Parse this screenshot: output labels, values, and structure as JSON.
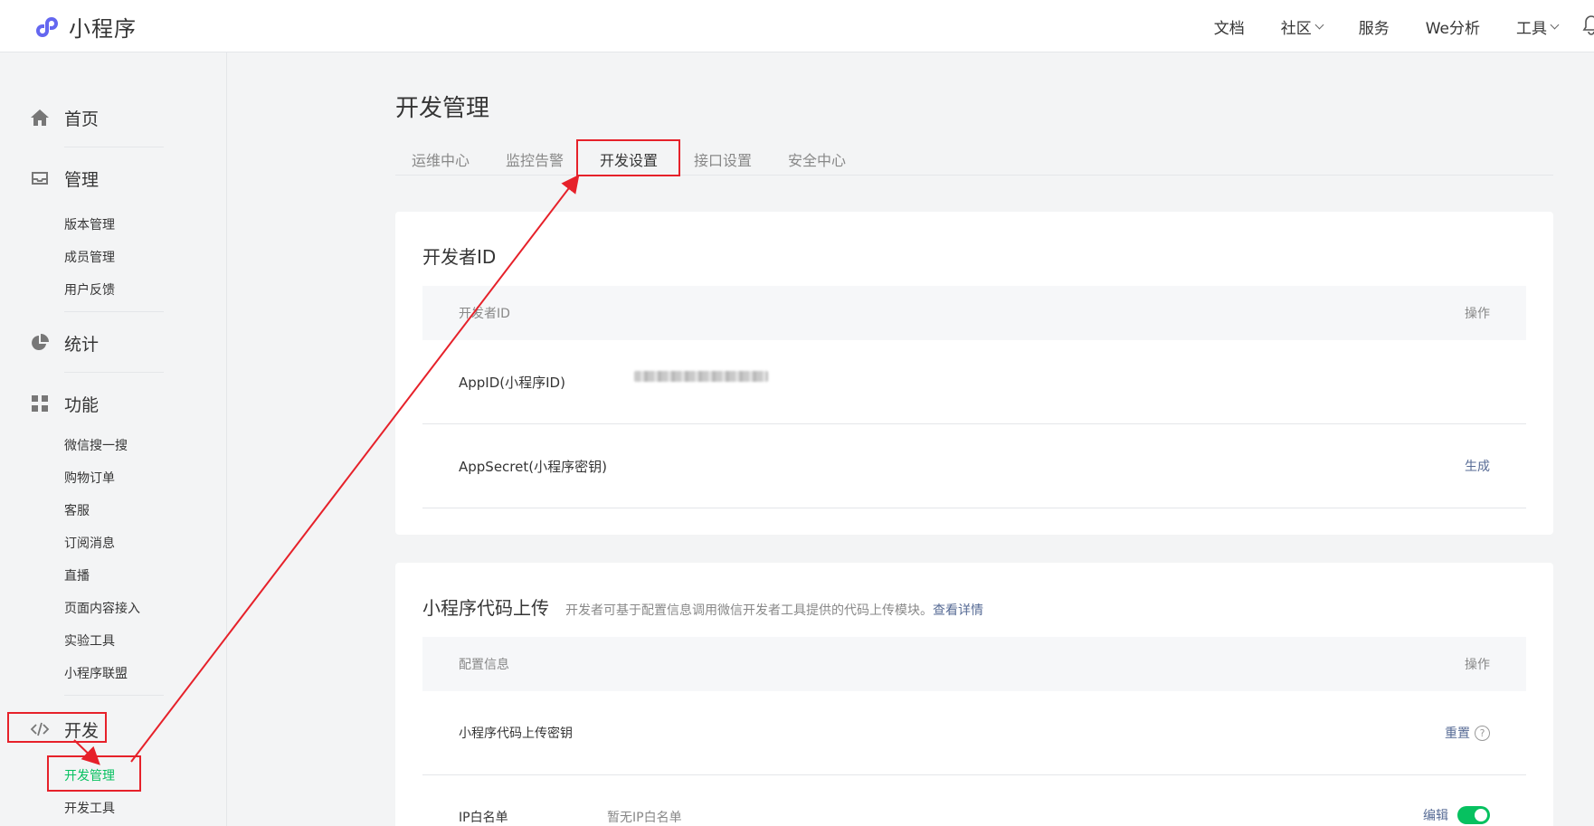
{
  "header": {
    "brand": "小程序",
    "nav": [
      {
        "label": "文档",
        "dropdown": false
      },
      {
        "label": "社区",
        "dropdown": true
      },
      {
        "label": "服务",
        "dropdown": false
      },
      {
        "label": "We分析",
        "dropdown": false
      },
      {
        "label": "工具",
        "dropdown": true
      }
    ]
  },
  "sidebar": {
    "home": "首页",
    "manage": "管理",
    "manage_items": [
      "版本管理",
      "成员管理",
      "用户反馈"
    ],
    "stats": "统计",
    "features": "功能",
    "feature_items": [
      "微信搜一搜",
      "购物订单",
      "客服",
      "订阅消息",
      "直播",
      "页面内容接入",
      "实验工具",
      "小程序联盟"
    ],
    "dev": "开发",
    "dev_items": [
      "开发管理",
      "开发工具"
    ]
  },
  "main": {
    "title": "开发管理",
    "tabs": [
      "运维中心",
      "监控告警",
      "开发设置",
      "接口设置",
      "安全中心"
    ],
    "active_tab": "开发设置",
    "developer_card": {
      "title": "开发者ID",
      "col_info": "开发者ID",
      "col_action": "操作",
      "rows": [
        {
          "label": "AppID(小程序ID)",
          "action": ""
        },
        {
          "label": "AppSecret(小程序密钥)",
          "action": "生成"
        }
      ]
    },
    "upload_card": {
      "title": "小程序代码上传",
      "desc": "开发者可基于配置信息调用微信开发者工具提供的代码上传模块。",
      "desc_link": "查看详情",
      "col_info": "配置信息",
      "col_action": "操作",
      "rows": [
        {
          "label": "小程序代码上传密钥",
          "value": "",
          "action": "重置"
        },
        {
          "label": "IP白名单",
          "value": "暂无IP白名单",
          "action": "编辑"
        }
      ]
    }
  },
  "colors": {
    "accent_green": "#07c160",
    "link_blue": "#576b95",
    "annotation_red": "#e6212a"
  }
}
